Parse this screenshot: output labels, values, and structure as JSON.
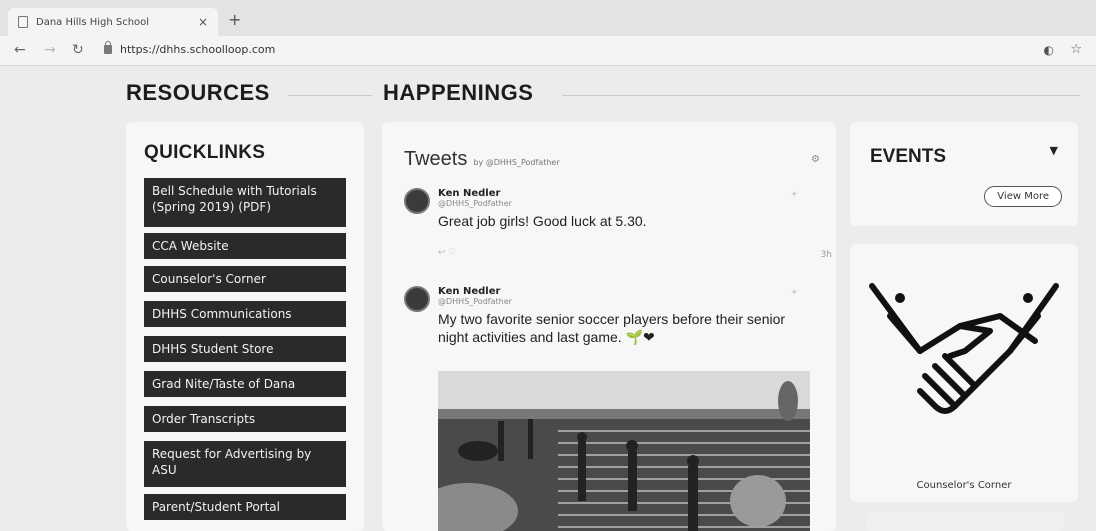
{
  "browser": {
    "tab_title": "Dana Hills High School",
    "tab_close": "×",
    "new_tab": "+",
    "url": "https://dhhs.schoolloop.com"
  },
  "sections": {
    "resources": "RESOURCES",
    "happenings": "HAPPENINGS"
  },
  "quicklinks": {
    "title": "QUICKLINKS",
    "items": [
      "Bell Schedule with Tutorials (Spring 2019) (PDF)",
      "CCA Website",
      "Counselor's Corner",
      "DHHS Communications",
      "DHHS Student Store",
      "Grad Nite/Taste of Dana",
      "Order Transcripts",
      "Request for Advertising by ASU",
      "Parent/Student Portal"
    ]
  },
  "tweets": {
    "title": "Tweets",
    "by": "by @DHHS_Podfather",
    "items": [
      {
        "name": "Ken Nedler",
        "handle": "@DHHS_Podfather",
        "text": "Great job girls! Good luck at 5.30.",
        "time": "3h"
      },
      {
        "name": "Ken Nedler",
        "handle": "@DHHS_Podfather",
        "text": "My two favorite senior soccer players before their senior night activities and last game. 🌱❤"
      }
    ]
  },
  "events": {
    "title": "EVENTS",
    "view_more": "View More",
    "card_label": "Counselor's Corner"
  },
  "colors": {
    "quicklink_bg": "#2a2a2a",
    "panel_bg": "#f7f7f7",
    "page_bg": "#ececec"
  }
}
